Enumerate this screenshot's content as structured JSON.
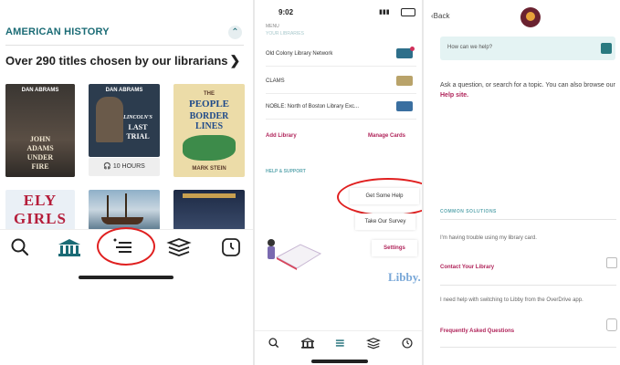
{
  "panel1": {
    "section_title": "AMERICAN HISTORY",
    "collapse_icon": "chevron-up-icon",
    "subtitle": "Over 290 titles chosen by our librarians",
    "chevron": "❯",
    "books": [
      {
        "author": "DAN ABRAMS",
        "title_lines": [
          "JOHN",
          "ADAMS",
          "UNDER",
          "FIRE"
        ]
      },
      {
        "author": "DAN ABRAMS",
        "title_lines": [
          "LINCOLN'S",
          "LAST",
          "TRIAL"
        ]
      },
      {
        "author": "",
        "title_lines": [
          "THE",
          "PEOPLE",
          "BORDER",
          "LINES"
        ],
        "bottom": "MARK STEIN"
      },
      {
        "author": "",
        "title_lines": [
          "ELY",
          "GIRLS"
        ]
      }
    ],
    "hours_label": "10 HOURS",
    "nav_icons": [
      "search-icon",
      "library-icon",
      "menu-icon",
      "shelf-icon",
      "timeline-icon"
    ]
  },
  "panel2": {
    "time": "9:02",
    "partial_label": "MENU",
    "partial_section": "YOUR LIBRARIES",
    "libraries": [
      {
        "name": "Old Colony Library Network",
        "card_color": "#2e6f8a"
      },
      {
        "name": "CLAMS",
        "card_color": "#b9a36a"
      },
      {
        "name": "NOBLE: North of Boston Library Exc...",
        "card_color": "#3a6fa0"
      }
    ],
    "add_library": "Add Library",
    "manage_cards": "Manage Cards",
    "help_section": "HELP & SUPPORT",
    "menu_items": {
      "get_help": "Get Some Help",
      "survey": "Take Our Survey",
      "settings": "Settings"
    },
    "brand": "Libby."
  },
  "panel3": {
    "back_label": "Back",
    "search_placeholder": "How can we help?",
    "intro_text": "Ask a question, or search for a topic. You can also browse our",
    "help_site_link": "Help site.",
    "common_heading": "COMMON SOLUTIONS",
    "solution1_text": "I'm having trouble using my library card.",
    "solution1_link": "Contact Your Library",
    "solution2_text": "I need help with switching to Libby from the OverDrive app.",
    "solution2_link": "Frequently Asked Questions"
  },
  "colors": {
    "teal": "#1a6b75",
    "crimson": "#b0245a",
    "highlight": "#e02020"
  }
}
